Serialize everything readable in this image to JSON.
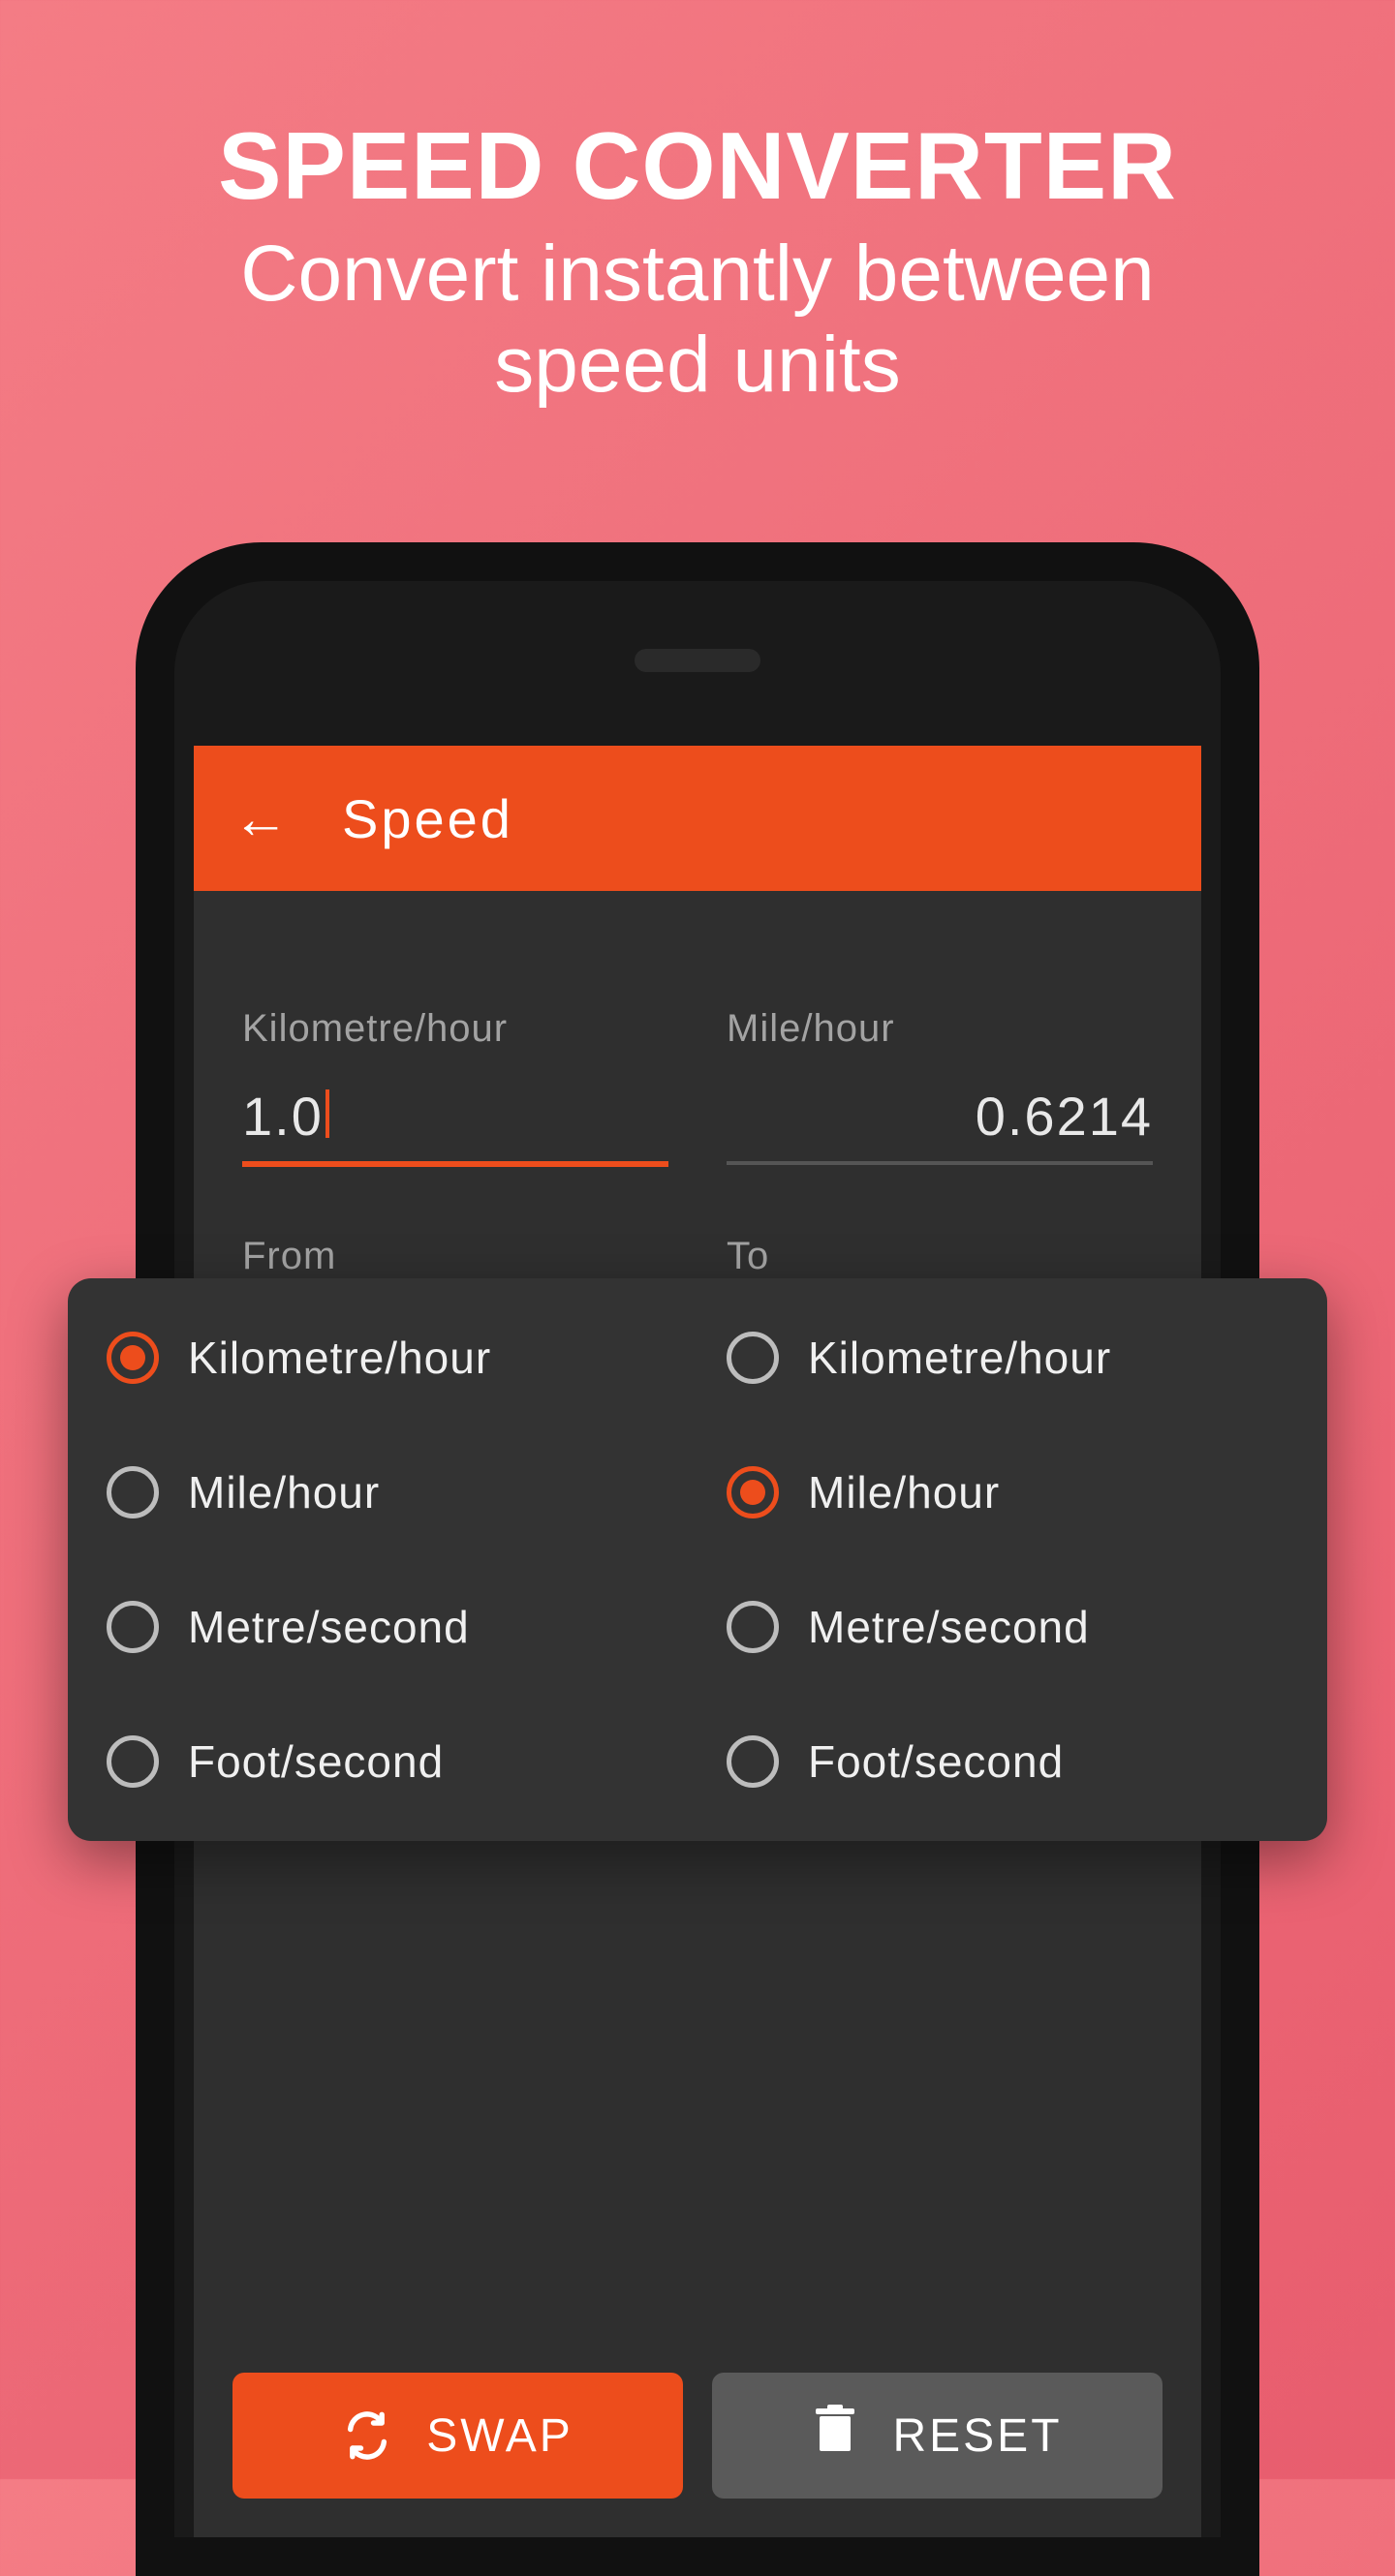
{
  "promo": {
    "title": "SPEED CONVERTER",
    "line1": "Convert instantly between",
    "line2": "speed units"
  },
  "appbar": {
    "title": "Speed"
  },
  "fields": {
    "from_label": "Kilometre/hour",
    "from_value": "1.0",
    "to_label": "Mile/hour",
    "to_value": "0.6214",
    "section_from": "From",
    "section_to": "To"
  },
  "units": {
    "from": [
      {
        "label": "Kilometre/hour",
        "selected": true
      },
      {
        "label": "Mile/hour",
        "selected": false
      },
      {
        "label": "Metre/second",
        "selected": false
      },
      {
        "label": "Foot/second",
        "selected": false
      }
    ],
    "to": [
      {
        "label": "Kilometre/hour",
        "selected": false
      },
      {
        "label": "Mile/hour",
        "selected": true
      },
      {
        "label": "Metre/second",
        "selected": false
      },
      {
        "label": "Foot/second",
        "selected": false
      }
    ]
  },
  "buttons": {
    "swap": "SWAP",
    "reset": "RESET"
  },
  "colors": {
    "accent": "#ed4d1c",
    "bg_dark": "#2f2f2f",
    "panel": "#333333"
  }
}
